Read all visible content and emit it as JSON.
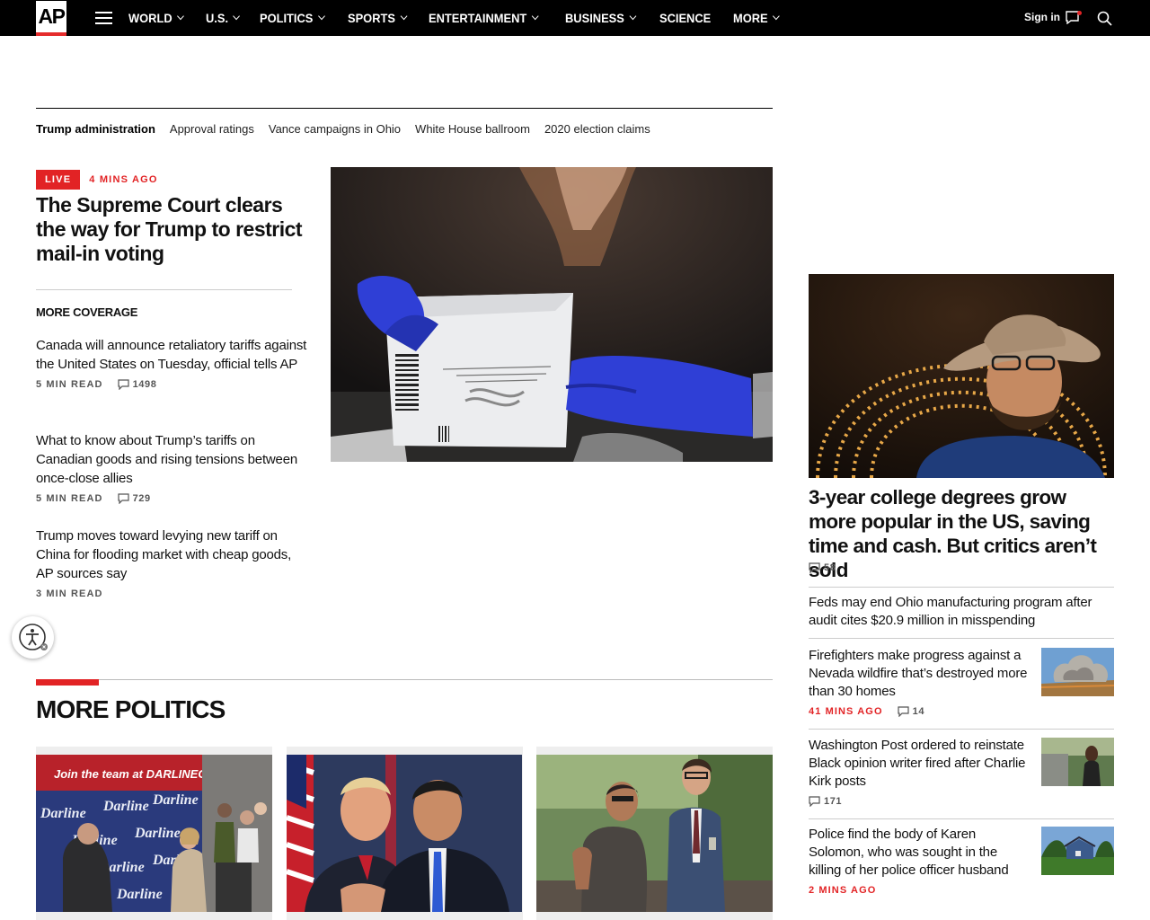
{
  "nav": {
    "logo": "AP",
    "items": [
      {
        "label": "WORLD",
        "dropdown": true
      },
      {
        "label": "U.S.",
        "dropdown": true
      },
      {
        "label": "POLITICS",
        "dropdown": true
      },
      {
        "label": "SPORTS",
        "dropdown": true
      },
      {
        "label": "ENTERTAINMENT",
        "dropdown": true
      },
      {
        "label": "BUSINESS",
        "dropdown": true
      },
      {
        "label": "SCIENCE",
        "dropdown": false
      },
      {
        "label": "MORE",
        "dropdown": true
      }
    ],
    "signin": "Sign in",
    "icons": [
      "menu-icon",
      "chat-icon",
      "search-icon"
    ]
  },
  "topics": [
    "Trump administration",
    "Approval ratings",
    "Vance campaigns in Ohio",
    "White House ballroom",
    "2020 election claims"
  ],
  "lead": {
    "badge": "LIVE",
    "time": "4 MINS AGO",
    "headline": "The Supreme Court clears the way for Trump to restrict mail-in voting",
    "photo_alt": "mail-in ballot envelope held in blue gloves"
  },
  "more_coverage": {
    "title": "MORE COVERAGE",
    "items": [
      {
        "headline": "Canada will announce retaliatory tariffs against the United States on Tuesday, official tells AP",
        "read": "5 MIN READ",
        "comments": "1498"
      },
      {
        "headline": "What to know about Trump’s tariffs on Canadian goods and rising tensions between once-close allies",
        "read": "5 MIN READ",
        "comments": "729"
      },
      {
        "headline": "Trump moves toward levying new tariff on China for flooding market with cheap goods, AP sources say",
        "read": "3 MIN READ",
        "comments": ""
      }
    ]
  },
  "more_politics": {
    "title": "MORE POLITICS",
    "banner_text": "Join the team at DARLINEGRAHAM.COM",
    "poster_word": "Darline"
  },
  "right": {
    "feature_headline": "3-year college degrees grow more popular in the US, saving time and cash. But critics aren’t sold",
    "feature_comments": "58",
    "items": [
      {
        "headline": "Feds may end Ohio manufacturing program after audit cites $20.9 million in misspending",
        "time": "",
        "comments": ""
      },
      {
        "headline": "Firefighters make progress against a Nevada wildfire that’s destroyed more than 30 homes",
        "time": "41 MINS AGO",
        "comments": "14"
      },
      {
        "headline": "Washington Post ordered to reinstate Black opinion writer fired after Charlie Kirk posts",
        "time": "",
        "comments": "171"
      },
      {
        "headline": "Police find the body of Karen Solomon, who was sought in the killing of her police officer husband",
        "time": "2 MINS AGO",
        "comments": ""
      }
    ]
  },
  "colors": {
    "accent_red": "#e22325",
    "nav_bg": "#000000"
  }
}
